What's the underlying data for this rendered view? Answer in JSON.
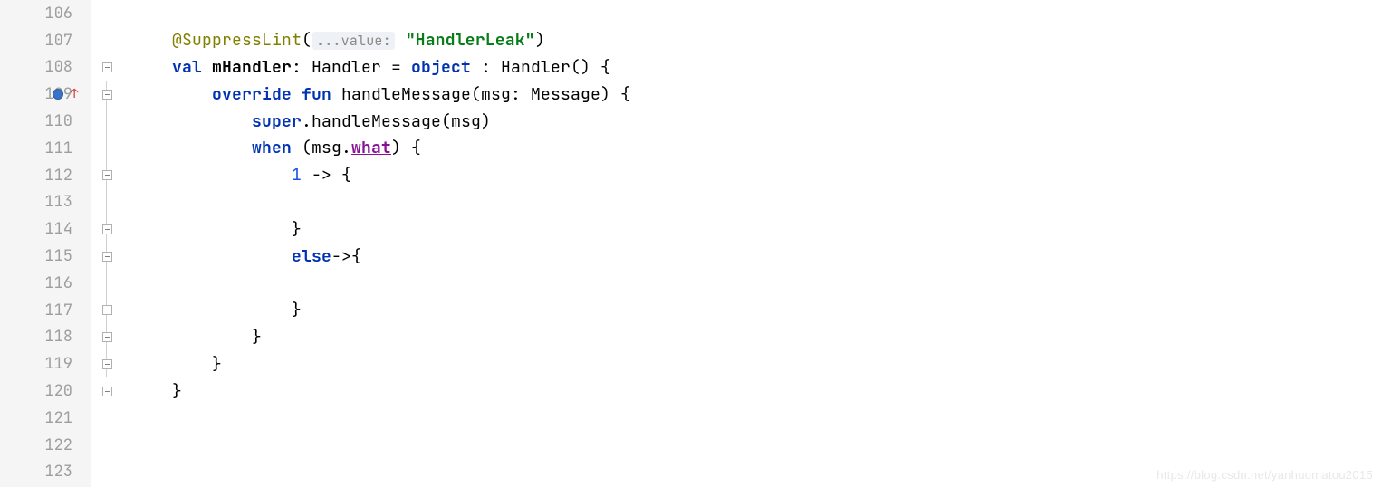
{
  "lines": [
    "106",
    "107",
    "108",
    "109",
    "110",
    "111",
    "112",
    "113",
    "114",
    "115",
    "116",
    "117",
    "118",
    "119",
    "120",
    "121",
    "122",
    "123"
  ],
  "code": {
    "l107": {
      "ann": "@SuppressLint",
      "paren_open": "(",
      "hint": "...value:",
      "str": "\"HandlerLeak\"",
      "paren_close": ")"
    },
    "l108": {
      "val": "val",
      "name": "mHandler",
      "colon": ":",
      "type": "Handler",
      "eq": "=",
      "object": "object",
      "colon2": ":",
      "ctor": "Handler()",
      "brace": "{"
    },
    "l109": {
      "override": "override",
      "fun": "fun",
      "fname": "handleMessage",
      "params": "(msg: Message)",
      "brace": "{"
    },
    "l110": {
      "super": "super",
      "dot": ".",
      "call": "handleMessage(msg)"
    },
    "l111": {
      "when": "when",
      "open": "(msg.",
      "what": "what",
      "close": ")",
      "brace": "{"
    },
    "l112": {
      "num": "1",
      "arrow": "->",
      "brace": "{"
    },
    "l114": {
      "brace": "}"
    },
    "l115": {
      "else": "else",
      "arrow": "->",
      "brace": "{"
    },
    "l117": {
      "brace": "}"
    },
    "l118": {
      "brace": "}"
    },
    "l119": {
      "brace": "}"
    },
    "l120": {
      "brace": "}"
    }
  },
  "watermark": "https://blog.csdn.net/yanhuomatou2015"
}
